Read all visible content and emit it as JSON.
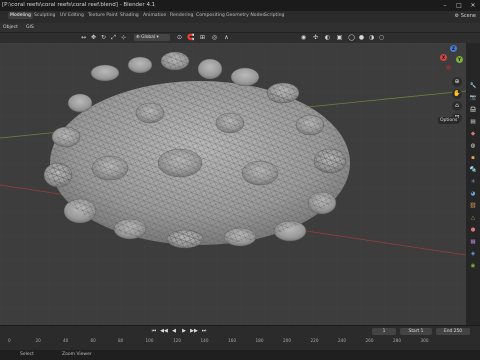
{
  "window": {
    "title": "[P:\\coral reefs\\coral reefs\\coral reef.blend] - Blender 4.1"
  },
  "menu_tabs": [
    "Modeling",
    "Sculpting",
    "UV Editing",
    "Texture Paint",
    "Shading",
    "Animation",
    "Rendering",
    "Compositing",
    "Geometry Nodes",
    "Scripting"
  ],
  "active_tab_index": 0,
  "scene_label": "Scene",
  "header": {
    "object_menu": "Object",
    "select_menu": "GIS"
  },
  "toolbar": {
    "orientation": "Global",
    "options": "Options"
  },
  "timeline": {
    "ticks": [
      "0",
      "20",
      "40",
      "60",
      "80",
      "100",
      "120",
      "140",
      "160",
      "180",
      "200",
      "220",
      "240",
      "260",
      "280",
      "300"
    ],
    "current_frame": "1",
    "start_label": "Start",
    "start_value": "1",
    "end_label": "End",
    "end_value": "250"
  },
  "statusbar": {
    "left": "Select",
    "mid": "Zoom Viewer"
  },
  "colors": {
    "background": "#3d3d3d",
    "axis_x": "#b43c3c",
    "axis_y": "#7fa33c",
    "accent": "#4772b3"
  }
}
